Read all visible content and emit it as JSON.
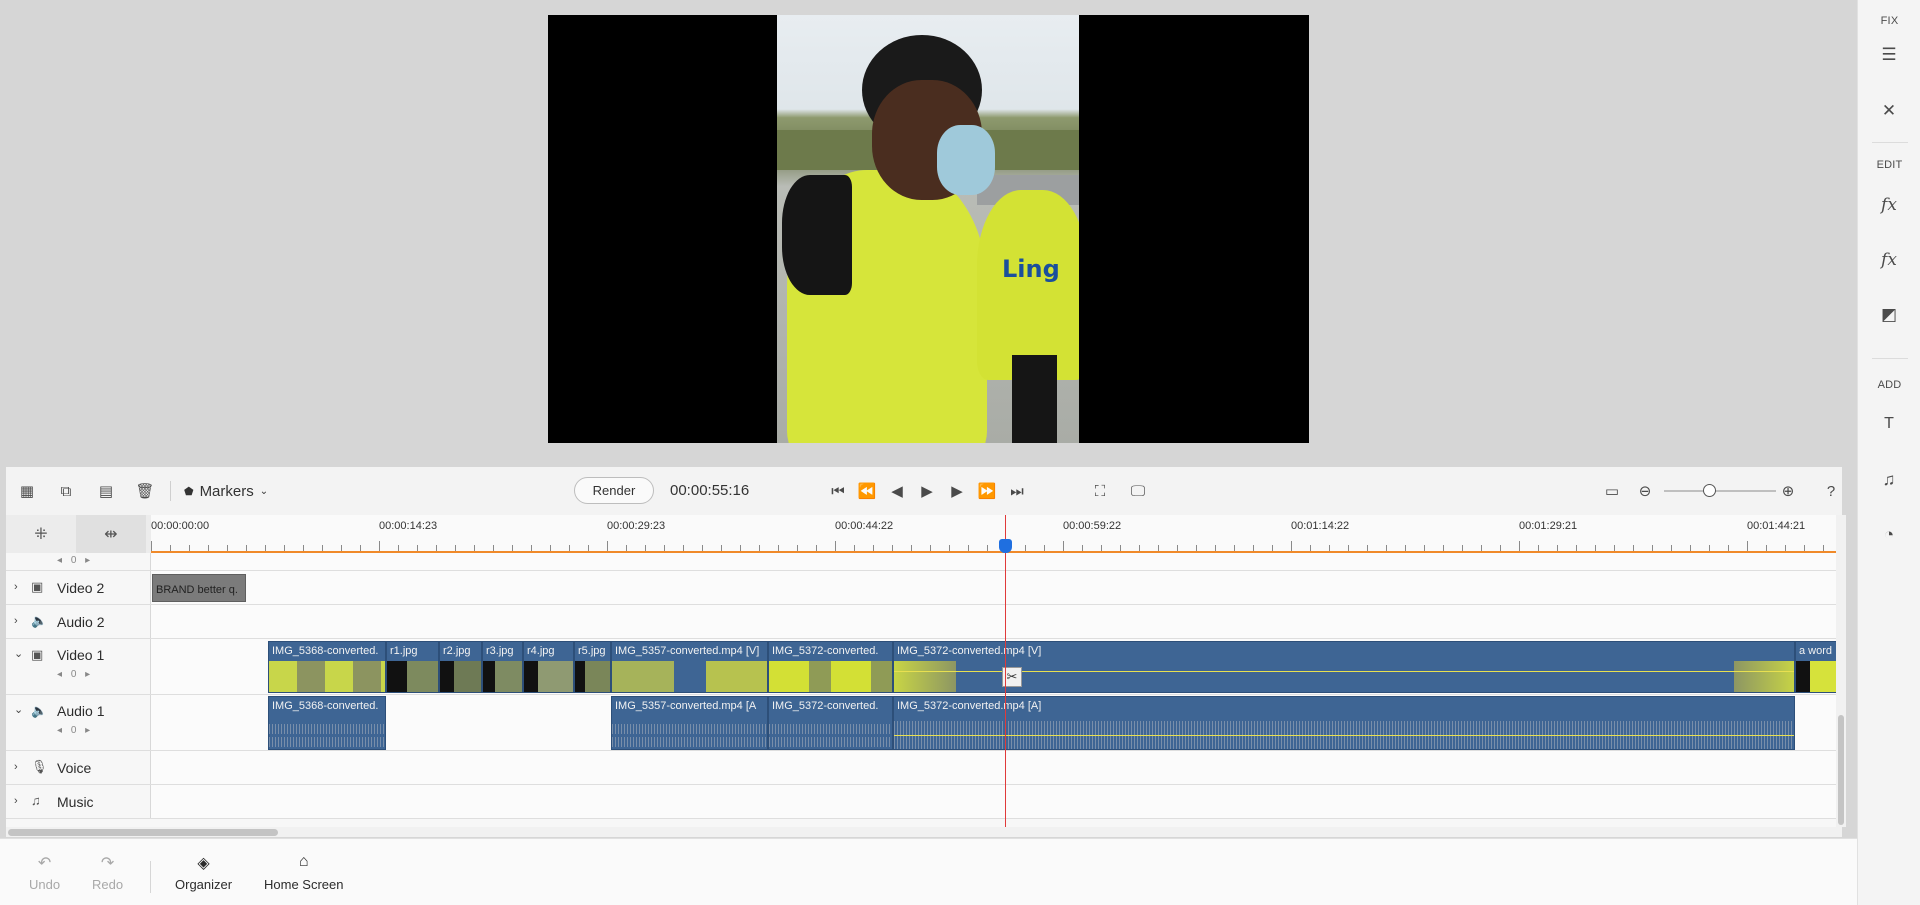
{
  "right_panel": {
    "fix_label": "FIX",
    "edit_label": "EDIT",
    "add_label": "ADD",
    "icons": [
      "adjust-icon",
      "tools-icon",
      "applied-effects-icon",
      "effects-icon",
      "color-icon",
      "title-icon",
      "music-icon",
      "graphics-icon"
    ]
  },
  "toolbar": {
    "markers_label": "Markers",
    "render_label": "Render",
    "timecode": "00:00:55:16"
  },
  "ruler": {
    "labels": [
      "00:00:00:00",
      "00:00:14:23",
      "00:00:29:23",
      "00:00:44:22",
      "00:00:59:22",
      "00:01:14:22",
      "00:01:29:21",
      "00:01:44:21"
    ]
  },
  "tracks": {
    "video2": {
      "name": "Video 2",
      "clip": "BRAND better q."
    },
    "audio2": {
      "name": "Audio 2"
    },
    "video1": {
      "name": "Video 1",
      "volume": "0",
      "clips": [
        "IMG_5368-converted.",
        "r1.jpg",
        "r2.jpg",
        "r3.jpg",
        "r4.jpg",
        "r5.jpg",
        "IMG_5357-converted.mp4 [V]",
        "IMG_5372-converted.",
        "IMG_5372-converted.mp4 [V]",
        "a word"
      ]
    },
    "audio1": {
      "name": "Audio 1",
      "volume": "0",
      "clips": [
        "IMG_5368-converted.",
        "IMG_5357-converted.mp4 [A",
        "IMG_5372-converted.",
        "IMG_5372-converted.mp4 [A]"
      ]
    },
    "voice": {
      "name": "Voice"
    },
    "music": {
      "name": "Music"
    },
    "top_volume": "0"
  },
  "bottom_bar": {
    "undo_label": "Undo",
    "redo_label": "Redo",
    "organizer_label": "Organizer",
    "home_label": "Home Screen"
  },
  "colors": {
    "clip": "#3e6594",
    "playhead": "#e03a3a",
    "ruler_line": "#f08a2a",
    "playhead_handle": "#1f6fe0"
  }
}
